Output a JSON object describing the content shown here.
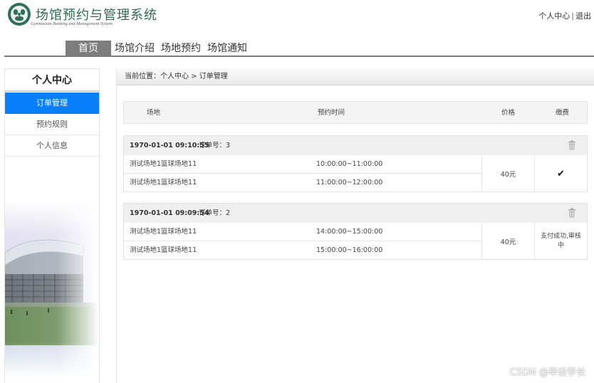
{
  "header": {
    "title": "场馆预约与管理系统",
    "subtitle": "Gymnasium Booking and Management System",
    "links": {
      "user_center": "个人中心",
      "separator": "|",
      "logout": "退出"
    }
  },
  "nav": {
    "items": [
      {
        "label": "首页",
        "active": true
      },
      {
        "label": "场馆介绍",
        "active": false
      },
      {
        "label": "场地预约",
        "active": false
      },
      {
        "label": "场馆通知",
        "active": false
      }
    ]
  },
  "sidebar": {
    "title": "个人中心",
    "items": [
      {
        "label": "订单管理",
        "active": true
      },
      {
        "label": "预约规则",
        "active": false
      },
      {
        "label": "个人信息",
        "active": false
      }
    ]
  },
  "breadcrumb": "当前位置：个人中心 > 订单管理",
  "table": {
    "columns": {
      "venue": "场地",
      "time": "预约时间",
      "price": "价格",
      "payment": "缴费"
    }
  },
  "orders": [
    {
      "date": "1970-01-01 09:10:55",
      "order_no": "订单号：3",
      "rows": [
        {
          "venue": "测试场地1篮球场地11",
          "time": "10:00:00~11:00:00"
        },
        {
          "venue": "测试场地1篮球场地11",
          "time": "11:00:00~12:00:00"
        }
      ],
      "price": "40元",
      "payment_status": "✔",
      "payment_icon": "check-icon"
    },
    {
      "date": "1970-01-01 09:09:54",
      "order_no": "订单号：2",
      "rows": [
        {
          "venue": "测试场地1篮球场地11",
          "time": "14:00:00~15:00:00"
        },
        {
          "venue": "测试场地1篮球场地11",
          "time": "15:00:00~16:00:00"
        }
      ],
      "price": "40元",
      "payment_status": "支付成功,审核中"
    }
  ],
  "watermark": "CSDN @毕设学长",
  "colors": {
    "accent": "#0a7ffc",
    "brand": "#2c6b4f",
    "nav_active": "#7d7d7d"
  }
}
